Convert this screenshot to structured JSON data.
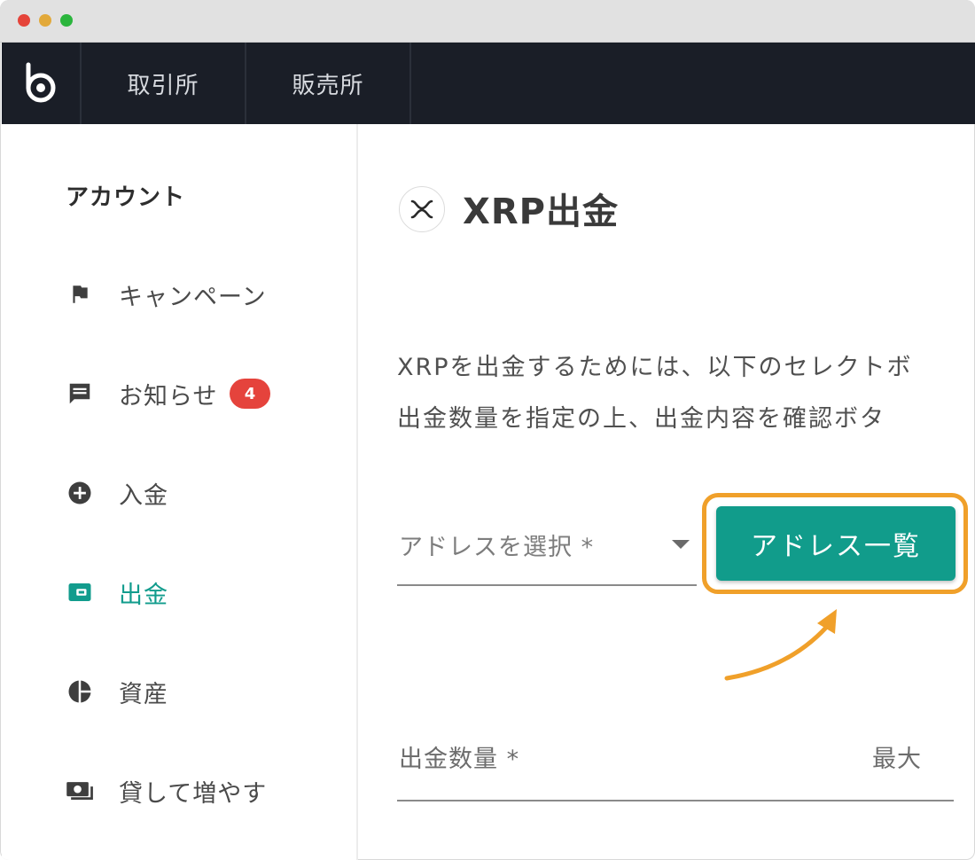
{
  "window": {
    "controls": [
      "close",
      "minimize",
      "maximize"
    ]
  },
  "topnav": {
    "logo_icon": "bitbank-logo-icon",
    "tabs": [
      {
        "label": "取引所"
      },
      {
        "label": "販売所"
      }
    ]
  },
  "sidebar": {
    "heading": "アカウント",
    "items": [
      {
        "label": "キャンペーン",
        "icon": "flag-icon"
      },
      {
        "label": "お知らせ",
        "icon": "message-icon",
        "badge": "4"
      },
      {
        "label": "入金",
        "icon": "plus-circle-icon"
      },
      {
        "label": "出金",
        "icon": "wallet-icon",
        "active": true
      },
      {
        "label": "資産",
        "icon": "pie-chart-icon"
      },
      {
        "label": "貸して増やす",
        "icon": "cash-icon"
      }
    ]
  },
  "main": {
    "coin_icon": "xrp-icon",
    "title": "XRP出金",
    "description_line1": "XRPを出金するためには、以下のセレクトボ",
    "description_line2": "出金数量を指定の上、出金内容を確認ボタ",
    "address_select_label": "アドレスを選択 *",
    "address_list_button": "アドレス一覧",
    "amount_label": "出金数量 *",
    "max_label": "最大"
  },
  "colors": {
    "accent": "#119c8b",
    "highlight": "#f0a02a",
    "nav_bg": "#1a1e27",
    "badge": "#e5433c"
  }
}
